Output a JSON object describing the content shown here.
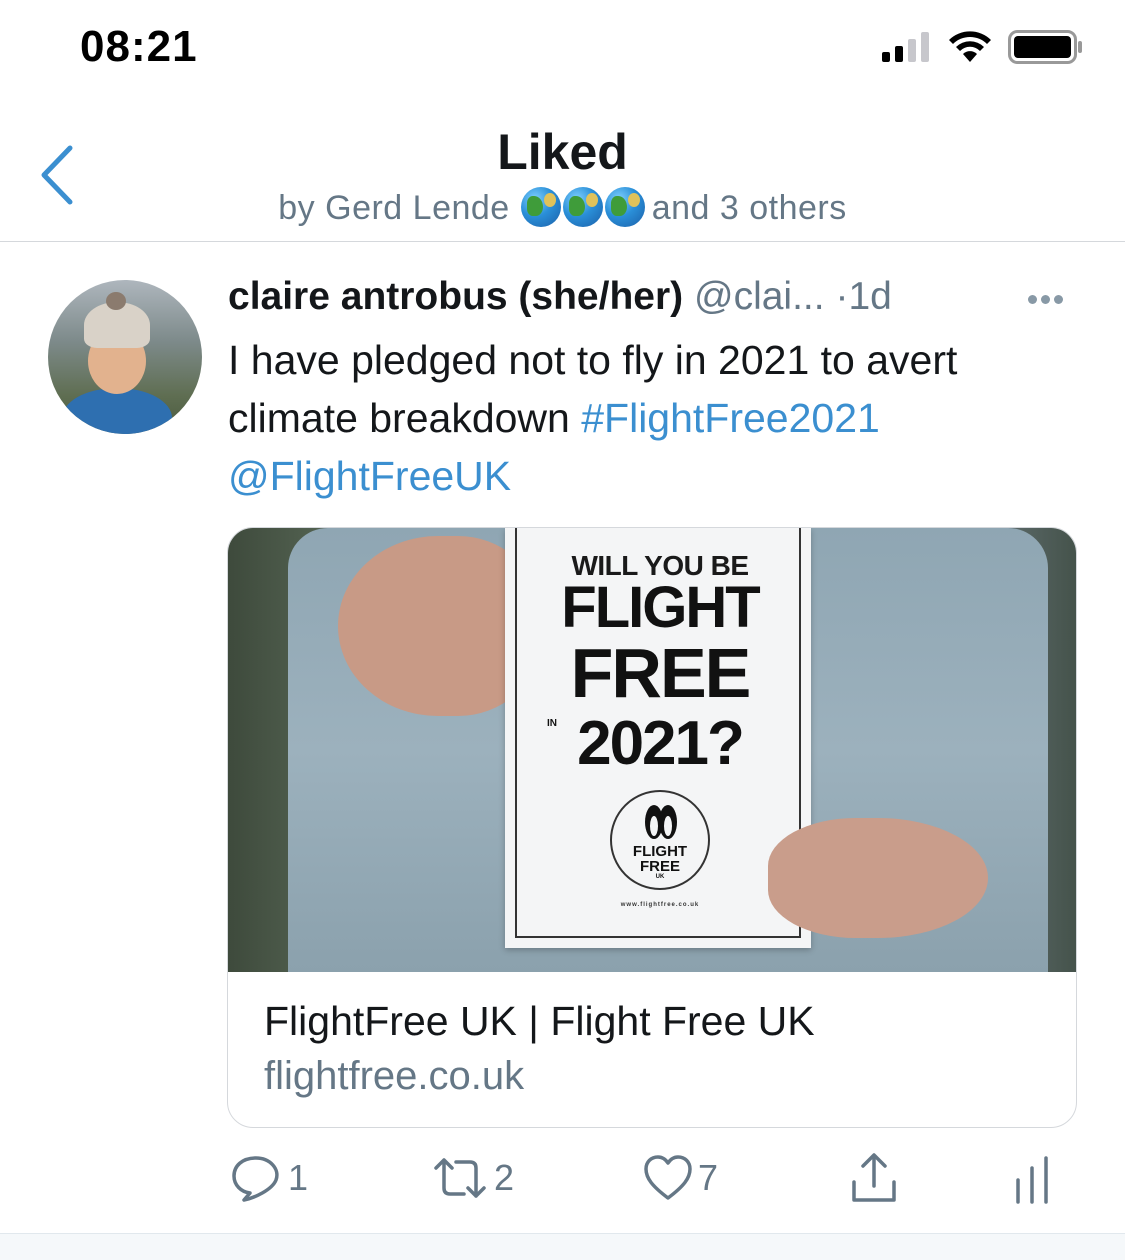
{
  "status_bar": {
    "time": "08:21"
  },
  "header": {
    "title": "Liked",
    "by_prefix": "by Gerd Lende",
    "emoji_icons": [
      "globe-europe-africa-icon",
      "globe-americas-icon",
      "globe-asia-australia-icon"
    ],
    "by_suffix": "and 3 others"
  },
  "tweet": {
    "author_name": "claire antrobus (she/her)",
    "handle": "@clai...",
    "separator": "·",
    "age": "1d",
    "text_plain": "I have pledged not to fly in 2021 to avert climate breakdown ",
    "hashtag": "#FlightFree2021",
    "mention": "@FlightFreeUK",
    "card": {
      "poster_line1": "WILL YOU BE",
      "poster_line2": "FLIGHT",
      "poster_line3": "FREE",
      "poster_in": "IN",
      "poster_line4": "2021?",
      "poster_logo_text": "FLIGHT FREE",
      "poster_logo_uk": "UK",
      "poster_url": "www.flightfree.co.uk",
      "title": "FlightFree UK | Flight Free UK",
      "domain": "flightfree.co.uk"
    },
    "actions": {
      "reply_count": "1",
      "retweet_count": "2",
      "like_count": "7"
    }
  },
  "colors": {
    "link": "#3b8fd0",
    "secondary_text": "#657786",
    "primary_text": "#14171a",
    "divider": "#d5d8dc"
  }
}
